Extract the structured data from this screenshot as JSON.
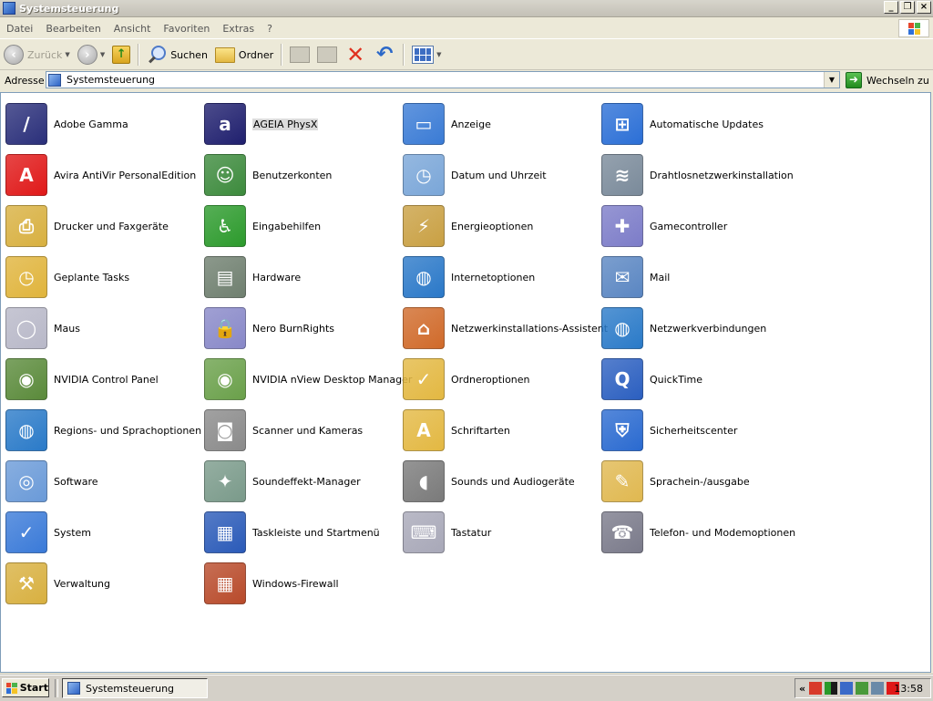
{
  "window": {
    "title": "Systemsteuerung"
  },
  "menu": [
    "Datei",
    "Bearbeiten",
    "Ansicht",
    "Favoriten",
    "Extras",
    "?"
  ],
  "toolbar": {
    "back": "Zurück",
    "search": "Suchen",
    "folders": "Ordner"
  },
  "address": {
    "label": "Adresse",
    "value": "Systemsteuerung",
    "go": "Wechseln zu"
  },
  "items": [
    {
      "label": "Adobe Gamma",
      "icon": "monitor-icon",
      "color": "#2a2f7a",
      "glyph": "/"
    },
    {
      "label": "AGEIA PhysX",
      "icon": "ageia-icon",
      "color": "#1f1f6e",
      "glyph": "a",
      "selected": true
    },
    {
      "label": "Anzeige",
      "icon": "display-icon",
      "color": "#3a7bd5",
      "glyph": "▭"
    },
    {
      "label": "Automatische Updates",
      "icon": "windows-update-icon",
      "color": "#2b6fd6",
      "glyph": "⊞"
    },
    {
      "label": "Avira AntiVir PersonalEdition",
      "icon": "avira-icon",
      "color": "#e01818",
      "glyph": "A"
    },
    {
      "label": "Benutzerkonten",
      "icon": "users-icon",
      "color": "#3c8a3c",
      "glyph": "☺"
    },
    {
      "label": "Datum und Uhrzeit",
      "icon": "clock-icon",
      "color": "#7aa6d8",
      "glyph": "◷"
    },
    {
      "label": "Drahtlosnetzwerkinstallation",
      "icon": "wireless-icon",
      "color": "#7a8a9a",
      "glyph": "≋"
    },
    {
      "label": "Drucker und Faxgeräte",
      "icon": "printer-icon",
      "color": "#d8b040",
      "glyph": "⎙"
    },
    {
      "label": "Eingabehilfen",
      "icon": "accessibility-icon",
      "color": "#2c9a2c",
      "glyph": "♿"
    },
    {
      "label": "Energieoptionen",
      "icon": "power-icon",
      "color": "#c9a043",
      "glyph": "⚡"
    },
    {
      "label": "Gamecontroller",
      "icon": "gamepad-icon",
      "color": "#7c7cc8",
      "glyph": "✚"
    },
    {
      "label": "Geplante Tasks",
      "icon": "scheduled-tasks-icon",
      "color": "#e0b43c",
      "glyph": "◷"
    },
    {
      "label": "Hardware",
      "icon": "hardware-icon",
      "color": "#6f7f6f",
      "glyph": "▤"
    },
    {
      "label": "Internetoptionen",
      "icon": "internet-icon",
      "color": "#2a78c8",
      "glyph": "◍"
    },
    {
      "label": "Mail",
      "icon": "mail-icon",
      "color": "#5a86c2",
      "glyph": "✉"
    },
    {
      "label": "Maus",
      "icon": "mouse-icon",
      "color": "#b8b8c8",
      "glyph": "◯"
    },
    {
      "label": "Nero BurnRights",
      "icon": "nero-icon",
      "color": "#8888c8",
      "glyph": "🔒"
    },
    {
      "label": "Netzwerkinstallations-Assistent",
      "icon": "network-setup-icon",
      "color": "#d06a2a",
      "glyph": "⌂"
    },
    {
      "label": "Netzwerkverbindungen",
      "icon": "network-connections-icon",
      "color": "#2a7ac8",
      "glyph": "◍"
    },
    {
      "label": "NVIDIA Control Panel",
      "icon": "nvidia-icon",
      "color": "#5a8a3a",
      "glyph": "◉"
    },
    {
      "label": "NVIDIA nView Desktop Manager",
      "icon": "nview-icon",
      "color": "#6aa04a",
      "glyph": "◉"
    },
    {
      "label": "Ordneroptionen",
      "icon": "folder-options-icon",
      "color": "#e3b842",
      "glyph": "✓"
    },
    {
      "label": "QuickTime",
      "icon": "quicktime-icon",
      "color": "#2b5fc0",
      "glyph": "Q"
    },
    {
      "label": "Regions- und Sprachoptionen",
      "icon": "globe-icon",
      "color": "#2a7ac8",
      "glyph": "◍"
    },
    {
      "label": "Scanner und Kameras",
      "icon": "scanner-icon",
      "color": "#8a8a8a",
      "glyph": "◙"
    },
    {
      "label": "Schriftarten",
      "icon": "fonts-icon",
      "color": "#e3b842",
      "glyph": "A"
    },
    {
      "label": "Sicherheitscenter",
      "icon": "security-shield-icon",
      "color": "#2a6ad0",
      "glyph": "⛨"
    },
    {
      "label": "Software",
      "icon": "software-icon",
      "color": "#6a9ad8",
      "glyph": "◎"
    },
    {
      "label": "Soundeffekt-Manager",
      "icon": "sound-effect-icon",
      "color": "#7a9a8a",
      "glyph": "✦"
    },
    {
      "label": "Sounds und Audiogeräte",
      "icon": "speaker-icon",
      "color": "#7a7a7a",
      "glyph": "◖"
    },
    {
      "label": "Sprachein-/ausgabe",
      "icon": "speech-icon",
      "color": "#e0b850",
      "glyph": "✎"
    },
    {
      "label": "System",
      "icon": "system-icon",
      "color": "#3a7ad8",
      "glyph": "✓"
    },
    {
      "label": "Taskleiste und Startmenü",
      "icon": "taskbar-icon",
      "color": "#2a5ab8",
      "glyph": "▦"
    },
    {
      "label": "Tastatur",
      "icon": "keyboard-icon",
      "color": "#a8a8b8",
      "glyph": "⌨"
    },
    {
      "label": "Telefon- und Modemoptionen",
      "icon": "phone-modem-icon",
      "color": "#7a7a8a",
      "glyph": "☎"
    },
    {
      "label": "Verwaltung",
      "icon": "admin-tools-icon",
      "color": "#d8b040",
      "glyph": "⚒"
    },
    {
      "label": "Windows-Firewall",
      "icon": "firewall-icon",
      "color": "#b84a2a",
      "glyph": "▦"
    }
  ],
  "taskbar": {
    "start": "Start",
    "task": "Systemsteuerung",
    "clock": "13:58",
    "chevron": "«"
  }
}
